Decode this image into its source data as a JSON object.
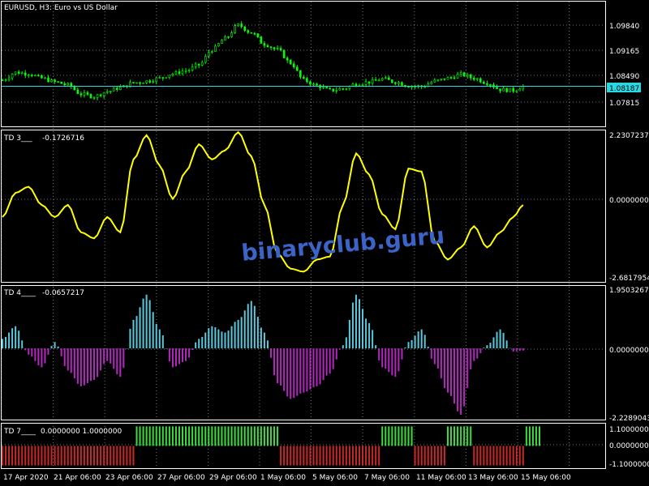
{
  "window": {
    "symbol_title": "EURUSD, H3:  Euro vs US Dollar"
  },
  "watermark": "binaryclub.guru",
  "colors": {
    "background": "#000000",
    "grid": "#ffffff",
    "bull_candle": "#00ff00",
    "bear_candle": "#00ff00",
    "bid_line": "#2ad8e0",
    "td3_line": "#ffff00",
    "hist_positive": "#5ac8dc",
    "hist_negative": "#b428c0",
    "td7_up": "#3cdc3c",
    "td7_down": "#c82828",
    "watermark": "#3c64c8"
  },
  "x_axis": {
    "labels": [
      "17 Apr 2020",
      "21 Apr 06:00",
      "23 Apr 06:00",
      "27 Apr 06:00",
      "29 Apr 06:00",
      "1 May 06:00",
      "5 May 06:00",
      "7 May 06:00",
      "11 May 06:00",
      "13 May 06:00",
      "15 May 06:00"
    ]
  },
  "chart_data": [
    {
      "type": "candlestick",
      "title": "EURUSD, H3:  Euro vs US Dollar",
      "ylim": [
        1.0715,
        1.104
      ],
      "y_ticks": [
        "1.09840",
        "1.09165",
        "1.08490",
        "1.07815"
      ],
      "current_price": "1.08187",
      "close_path": [
        [
          0,
          1.0835
        ],
        [
          4,
          1.0855
        ],
        [
          8,
          1.0852
        ],
        [
          12,
          1.084
        ],
        [
          16,
          1.083
        ],
        [
          20,
          1.0822
        ],
        [
          24,
          1.0798
        ],
        [
          28,
          1.0792
        ],
        [
          32,
          1.0805
        ],
        [
          36,
          1.0815
        ],
        [
          40,
          1.0828
        ],
        [
          44,
          1.0832
        ],
        [
          48,
          1.084
        ],
        [
          52,
          1.0852
        ],
        [
          56,
          1.086
        ],
        [
          60,
          1.0875
        ],
        [
          64,
          1.0915
        ],
        [
          68,
          1.0945
        ],
        [
          72,
          1.098
        ],
        [
          76,
          1.096
        ],
        [
          80,
          1.093
        ],
        [
          84,
          1.0915
        ],
        [
          88,
          1.088
        ],
        [
          92,
          1.0835
        ],
        [
          96,
          1.082
        ],
        [
          100,
          1.0808
        ],
        [
          104,
          1.0812
        ],
        [
          108,
          1.0825
        ],
        [
          112,
          1.083
        ],
        [
          116,
          1.0838
        ],
        [
          120,
          1.083
        ],
        [
          124,
          1.082
        ],
        [
          128,
          1.0818
        ],
        [
          132,
          1.0832
        ],
        [
          136,
          1.084
        ],
        [
          140,
          1.085
        ],
        [
          144,
          1.084
        ],
        [
          148,
          1.0828
        ],
        [
          152,
          1.081
        ],
        [
          156,
          1.0808
        ],
        [
          159,
          1.0818
        ]
      ]
    },
    {
      "type": "line",
      "title": "TD 3___",
      "current_value": "-0.1726716",
      "ylim": [
        -2.6817954,
        2.2307237
      ],
      "y_ticks": [
        "2.2307237",
        "0.0000000",
        "-2.6817954"
      ],
      "x": [
        0,
        4,
        8,
        12,
        16,
        20,
        24,
        28,
        32,
        36,
        40,
        44,
        48,
        52,
        56,
        60,
        64,
        68,
        72,
        76,
        80,
        84,
        88,
        92,
        96,
        100,
        104,
        108,
        112,
        116,
        120,
        124,
        128,
        132,
        136,
        140,
        144,
        148,
        152,
        156,
        159
      ],
      "values": [
        -0.6,
        0.2,
        0.4,
        -0.2,
        -0.6,
        -0.2,
        -1.1,
        -1.3,
        -0.6,
        -1.1,
        1.3,
        2.1,
        1.1,
        0.0,
        0.9,
        1.8,
        1.3,
        1.6,
        2.2,
        1.4,
        -0.2,
        -1.8,
        -2.3,
        -2.4,
        -2.0,
        -1.9,
        -0.2,
        1.5,
        0.8,
        -0.5,
        -1.0,
        1.0,
        0.9,
        -1.4,
        -2.0,
        -1.6,
        -0.9,
        -1.6,
        -1.1,
        -0.6,
        -0.2
      ]
    },
    {
      "type": "bar",
      "title": "TD 4____",
      "current_value": "-0.0657217",
      "ylim": [
        -2.2289043,
        1.9503267
      ],
      "y_ticks": [
        "1.9503267",
        "0.0000000",
        "-2.2289043"
      ],
      "x": [
        0,
        4,
        8,
        12,
        16,
        20,
        24,
        28,
        32,
        36,
        40,
        44,
        48,
        52,
        56,
        60,
        64,
        68,
        72,
        76,
        80,
        84,
        88,
        92,
        96,
        100,
        104,
        108,
        112,
        116,
        120,
        124,
        128,
        132,
        136,
        140,
        144,
        148,
        152,
        156,
        159
      ],
      "values": [
        0.3,
        0.7,
        -0.2,
        -0.6,
        0.2,
        -0.7,
        -1.2,
        -1.0,
        -0.4,
        -0.9,
        0.9,
        1.7,
        0.6,
        -0.6,
        -0.4,
        0.3,
        0.7,
        0.5,
        0.9,
        1.5,
        0.5,
        -1.1,
        -1.6,
        -1.4,
        -1.2,
        -0.8,
        0.1,
        1.7,
        0.8,
        -0.6,
        -0.9,
        0.2,
        0.6,
        -0.5,
        -1.4,
        -2.1,
        -0.4,
        0.1,
        0.6,
        -0.1,
        -0.07
      ]
    },
    {
      "type": "bar",
      "title": "TD 7____",
      "current_value": "0.0000000 1.0000000",
      "ylim": [
        -1.1,
        1.1
      ],
      "y_ticks": [
        "1.1000000",
        "0.0000000",
        "-1.1000000"
      ],
      "segments": [
        {
          "from": 0,
          "to": 40,
          "value": -1
        },
        {
          "from": 41,
          "to": 84,
          "value": 1
        },
        {
          "from": 85,
          "to": 115,
          "value": -1
        },
        {
          "from": 116,
          "to": 125,
          "value": 1
        },
        {
          "from": 126,
          "to": 135,
          "value": -1
        },
        {
          "from": 136,
          "to": 143,
          "value": 1
        },
        {
          "from": 144,
          "to": 159,
          "value": -1
        },
        {
          "from": 160,
          "to": 164,
          "value": 1
        }
      ]
    }
  ]
}
